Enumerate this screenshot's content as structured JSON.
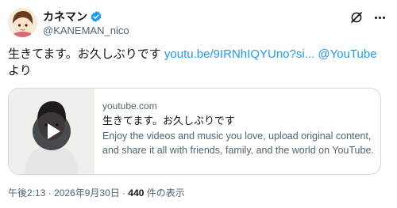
{
  "user": {
    "display_name": "カネマン",
    "handle": "@KANEMAN_nico",
    "verified": true,
    "verified_color": "#1d9bf0"
  },
  "tweet": {
    "text_part1": "生きてます。お久しぶりです ",
    "link_url": "youtu.be/9IRNhIQYUno?si...",
    "text_space": " ",
    "link_mention": "@YouTube",
    "text_part2": "より"
  },
  "card": {
    "domain": "youtube.com",
    "title": "生きてます。お久しぶりです",
    "description": "Enjoy the videos and music you love, upload original content, and share it all with friends, family, and the world on YouTube."
  },
  "meta": {
    "time": "午後2:13",
    "sep1": " · ",
    "date": "2026年9月30日",
    "sep2": " · ",
    "views": "440",
    "views_label": " 件の表示"
  },
  "icons": {
    "grok": "grok-icon",
    "more": "more-icon",
    "play": "play-icon",
    "verified": "verified-badge-icon"
  },
  "colors": {
    "link": "#1d9bf0",
    "secondary_text": "#536471",
    "border": "#cfd9de"
  }
}
